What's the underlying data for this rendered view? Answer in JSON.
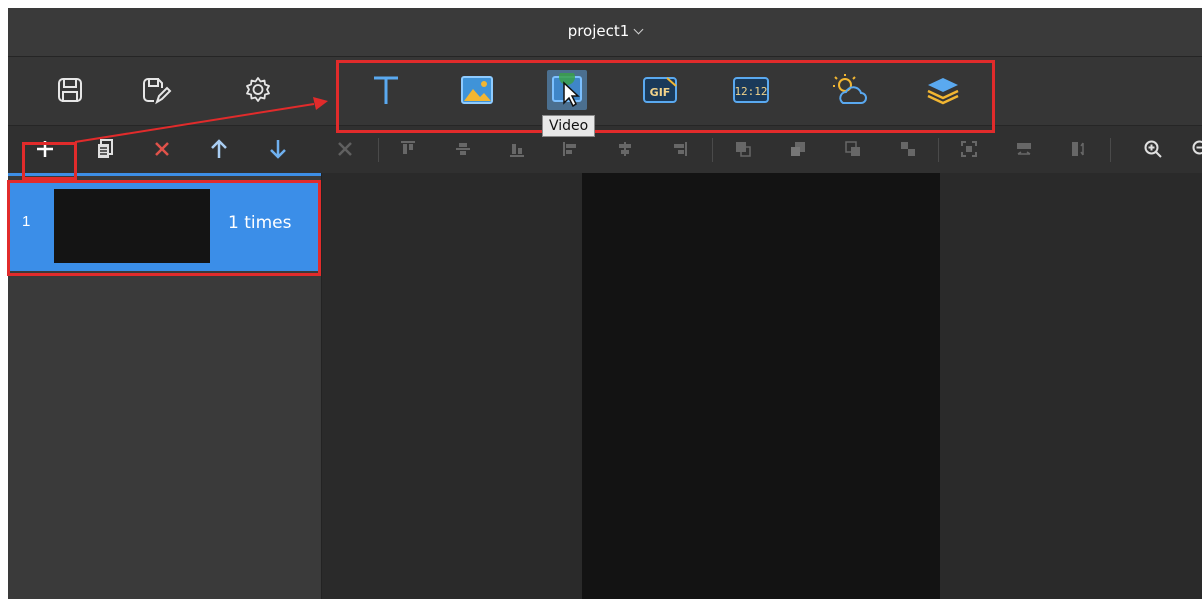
{
  "window": {
    "title": "project1"
  },
  "toolbar_main": {
    "file_buttons": [
      {
        "name": "save-icon"
      },
      {
        "name": "save-as-icon"
      },
      {
        "name": "settings-icon"
      }
    ],
    "media_buttons": [
      {
        "name": "text-icon",
        "label": ""
      },
      {
        "name": "image-icon",
        "label": ""
      },
      {
        "name": "video-icon",
        "label": ""
      },
      {
        "name": "gif-icon",
        "label": "GIF"
      },
      {
        "name": "clock-icon",
        "label": "12:12"
      },
      {
        "name": "weather-icon",
        "label": ""
      },
      {
        "name": "layers-icon",
        "label": ""
      }
    ],
    "tooltip": "Video"
  },
  "program_list": {
    "items": [
      {
        "index": "1",
        "repeat": "1  times"
      }
    ]
  },
  "colors": {
    "accent": "#3b8ee8",
    "highlight": "#e12b2b",
    "background": "#2f2f2f",
    "icon_blue": "#5aa9f0",
    "icon_yellow": "#f2b632"
  }
}
